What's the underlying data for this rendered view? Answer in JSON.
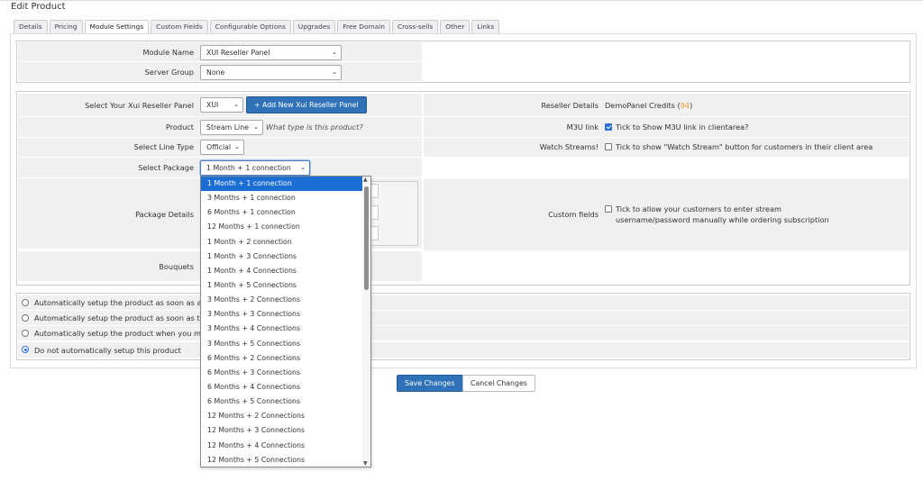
{
  "page": {
    "title": "Edit Product"
  },
  "tabs": [
    {
      "label": "Details"
    },
    {
      "label": "Pricing"
    },
    {
      "label": "Module Settings"
    },
    {
      "label": "Custom Fields"
    },
    {
      "label": "Configurable Options"
    },
    {
      "label": "Upgrades"
    },
    {
      "label": "Free Domain"
    },
    {
      "label": "Cross-sells"
    },
    {
      "label": "Other"
    },
    {
      "label": "Links"
    }
  ],
  "module": {
    "module_name_label": "Module Name",
    "module_name_value": "XUI Reseller Panel",
    "server_group_label": "Server Group",
    "server_group_value": "None"
  },
  "settings": {
    "panel_label": "Select Your Xui Reseller Panel",
    "panel_value": "XUI",
    "add_panel_button": "+ Add New Xui Reseller Panel",
    "product_label": "Product",
    "product_value": "Stream Line",
    "product_hint": "What type is this product?",
    "line_type_label": "Select Line Type",
    "line_type_value": "Official",
    "package_label": "Select Package",
    "package_value": "1 Month + 1 connection",
    "package_details_label": "Package Details",
    "bouquets_label": "Bouquets",
    "reseller_details_label": "Reseller Details",
    "reseller_details_text": "DemoPanel Credits (",
    "reseller_credits": "94",
    "reseller_details_close": ")",
    "m3u_label": "M3U link",
    "m3u_text": "Tick to Show M3U link in clientarea?",
    "watch_label": "Watch Streams!",
    "watch_text": "Tick to show \"Watch Stream\" button for customers in their client area",
    "custom_fields_label": "Custom fields",
    "custom_fields_text_1": "Tick to allow your customers to enter stream",
    "custom_fields_text_2": "username/password manually while ordering subscription"
  },
  "autosetup": [
    {
      "label": "Automatically setup the product as soon as an",
      "checked": false
    },
    {
      "label": "Automatically setup the product as soon as the",
      "checked": false
    },
    {
      "label": "Automatically setup the product when you mar",
      "checked": false
    },
    {
      "label": "Do not automatically setup this product",
      "checked": true
    }
  ],
  "buttons": {
    "save": "Save Changes",
    "cancel": "Cancel Changes"
  },
  "package_options": [
    "1 Month + 1 connection",
    "3 Months + 1 connection",
    "6 Months + 1 connection",
    "12 Months + 1 connection",
    "1 Month + 2 connection",
    "1 Month + 3 Connections",
    "1 Month + 4 Connections",
    "1 Month + 5 Connections",
    "3 Months + 2 Connections",
    "3 Months + 3 Connections",
    "3 Months + 4 Connections",
    "3 Months + 5 Connections",
    "6 Months + 2 Connections",
    "6 Months + 3 Connections",
    "6 Months + 4 Connections",
    "6 Months + 5 Connections",
    "12 Months + 2 Connections",
    "12 Months + 3 Connections",
    "12 Months + 4 Connections",
    "12 Months + 5 Connections"
  ],
  "colors": {
    "primary": "#2f72b8",
    "selected_option": "#1c6ed4",
    "credits": "#f0a030"
  }
}
